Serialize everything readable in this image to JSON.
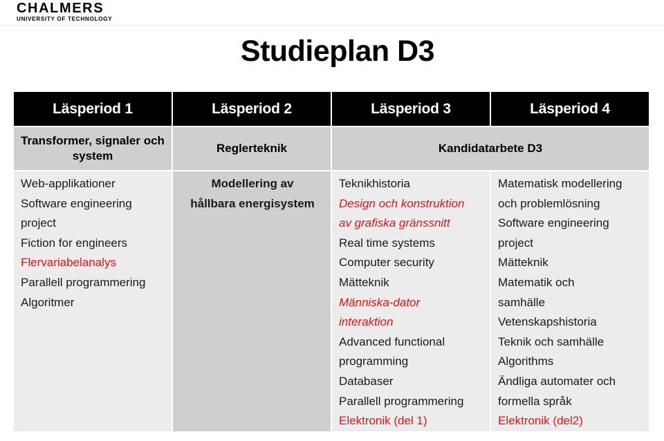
{
  "brand": {
    "wordmark": "CHALMERS",
    "subtitle": "UNIVERSITY OF TECHNOLOGY"
  },
  "page": {
    "title": "Studieplan D3"
  },
  "colors": {
    "header_background": "#000000",
    "header_text": "#ffffff",
    "group_band": "#cfcfcf",
    "list_background": "#ececec",
    "highlight_red": "#ee1111"
  },
  "table": {
    "period_headers": [
      {
        "label": "Läsperiod 1"
      },
      {
        "label": "Läsperiod 2"
      },
      {
        "label": "Läsperiod 3"
      },
      {
        "label": "Läsperiod 4"
      }
    ],
    "group_row": [
      {
        "label": "Transformer, signaler\noch system",
        "colspan": 1
      },
      {
        "label": "Reglerteknik",
        "colspan": 1
      },
      {
        "label": "Kandidatarbete D3",
        "colspan": 2
      }
    ],
    "columns": [
      {
        "period": "Läsperiod 1",
        "items": [
          {
            "text": "Web-applikationer",
            "style": "normal"
          },
          {
            "text": "Software engineering\nproject",
            "style": "normal"
          },
          {
            "text": "Fiction for engineers",
            "style": "normal"
          },
          {
            "text": "Flervariabelanalys",
            "style": "red"
          },
          {
            "text": "Parallell programmering",
            "style": "normal"
          },
          {
            "text": "Algoritmer",
            "style": "normal"
          }
        ]
      },
      {
        "period": "Läsperiod 2",
        "items": [
          {
            "text": "Modellering av\nhållbara energisystem",
            "style": "bold-center"
          }
        ]
      },
      {
        "period": "Läsperiod 3",
        "items": [
          {
            "text": "Teknikhistoria",
            "style": "normal"
          },
          {
            "text": "Design och konstruktion\nav grafiska gränssnitt",
            "style": "red-italic"
          },
          {
            "text": "Real time systems",
            "style": "normal"
          },
          {
            "text": "Computer security",
            "style": "normal"
          },
          {
            "text": "Mätteknik",
            "style": "normal"
          },
          {
            "text": "Människa-dator\ninteraktion",
            "style": "red-italic"
          },
          {
            "text": "Advanced functional\nprogramming",
            "style": "normal"
          },
          {
            "text": "Databaser",
            "style": "normal"
          },
          {
            "text": "Parallell programmering",
            "style": "normal"
          },
          {
            "text": "Elektronik (del 1)",
            "style": "red"
          }
        ]
      },
      {
        "period": "Läsperiod 4",
        "items": [
          {
            "text": "Matematisk modellering\noch problemlösning",
            "style": "normal"
          },
          {
            "text": "Software engineering\nproject",
            "style": "normal"
          },
          {
            "text": "Mätteknik",
            "style": "normal"
          },
          {
            "text": "Matematik och\nsamhälle",
            "style": "normal"
          },
          {
            "text": "Vetenskapshistoria",
            "style": "normal"
          },
          {
            "text": "Teknik och samhälle",
            "style": "normal"
          },
          {
            "text": "Algorithms",
            "style": "normal"
          },
          {
            "text": "Ändliga automater och\nformella språk",
            "style": "normal"
          },
          {
            "text": "Elektronik (del2)",
            "style": "red"
          }
        ]
      }
    ]
  }
}
